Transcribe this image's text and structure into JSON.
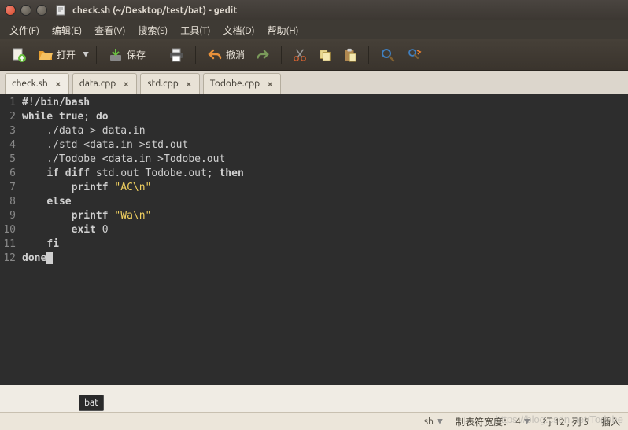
{
  "window": {
    "title": "check.sh (~/Desktop/test/bat) - gedit"
  },
  "menu": {
    "file": "文件(F)",
    "edit": "编辑(E)",
    "view": "查看(V)",
    "search": "搜索(S)",
    "tools": "工具(T)",
    "docs": "文档(D)",
    "help": "帮助(H)"
  },
  "toolbar": {
    "open": "打开",
    "save": "保存",
    "undo": "撤消"
  },
  "tabs": [
    {
      "label": "check.sh",
      "active": true
    },
    {
      "label": "data.cpp",
      "active": false
    },
    {
      "label": "std.cpp",
      "active": false
    },
    {
      "label": "Todobe.cpp",
      "active": false
    }
  ],
  "code": {
    "lines": [
      "#!/bin/bash",
      "while true; do",
      "    ./data > data.in",
      "    ./std <data.in >std.out",
      "    ./Todobe <data.in >Todobe.out",
      "    if diff std.out Todobe.out; then",
      "        printf \"AC\\n\"",
      "    else",
      "        printf \"Wa\\n\"",
      "        exit 0",
      "    fi",
      "done"
    ],
    "line_count": 12
  },
  "tooltip": "bat",
  "status": {
    "lang": "sh",
    "tabwidth_label": "制表符宽度：",
    "tabwidth_value": "4",
    "cursor": "行 12 , 列 5",
    "mode": "插入"
  },
  "watermark": "https://blog.csdn.net/Todobe"
}
